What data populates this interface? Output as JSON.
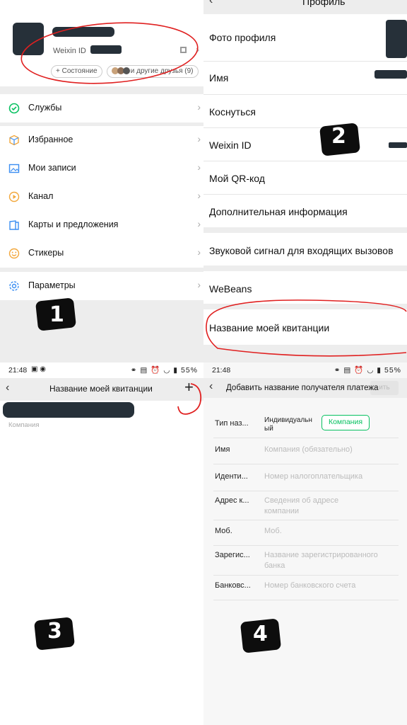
{
  "panel1": {
    "weixin_id_label": "Weixin ID",
    "status_chip": "+ Состояние",
    "friends_chip": "и другие друзья (9)",
    "menu": [
      {
        "label": "Службы",
        "icon": "services-icon"
      },
      {
        "label": "Избранное",
        "icon": "favorites-cube-icon"
      },
      {
        "label": "Мои записи",
        "icon": "moments-image-icon"
      },
      {
        "label": "Канал",
        "icon": "channel-play-icon"
      },
      {
        "label": "Карты и предложения",
        "icon": "cards-icon"
      },
      {
        "label": "Стикеры",
        "icon": "stickers-smile-icon"
      },
      {
        "label": "Параметры",
        "icon": "settings-gear-icon"
      }
    ],
    "annotation_number": "1"
  },
  "panel2": {
    "title": "Профиль",
    "rows": [
      "Фото профиля",
      "Имя",
      "Коснуться",
      "Weixin ID",
      "Мой QR-код",
      "Дополнительная информация",
      "Звуковой сигнал для входящих вызовов",
      "WeBeans",
      "Название моей квитанции"
    ],
    "annotation_number": "2"
  },
  "panel3": {
    "status_time": "21:48",
    "status_battery": "55%",
    "nav_title": "Название моей квитанции",
    "item_subtitle": "Компания",
    "annotation_number": "3"
  },
  "panel4": {
    "status_time": "21:48",
    "status_battery": "55%",
    "nav_title": "Добавить название получателя платежа",
    "save_label": "ить",
    "type_label": "Тип наз...",
    "type_individual": "Индивидуальн ый",
    "type_company": "Компания",
    "fields": [
      {
        "label": "Имя",
        "placeholder": "Компания (обязательно)"
      },
      {
        "label": "Иденти...",
        "placeholder": "Номер налогоплательщика"
      },
      {
        "label": "Адрес к...",
        "placeholder": "Сведения об адресе компании"
      },
      {
        "label": "Моб.",
        "placeholder": "Моб."
      },
      {
        "label": "Зарегис...",
        "placeholder": "Название зарегистрированного банка"
      },
      {
        "label": "Банковс...",
        "placeholder": "Номер банковского счета"
      }
    ],
    "annotation_number": "4"
  },
  "colors": {
    "wechat_green": "#07c160",
    "annotation_red": "#e02020",
    "redaction_dark": "#16202a"
  }
}
